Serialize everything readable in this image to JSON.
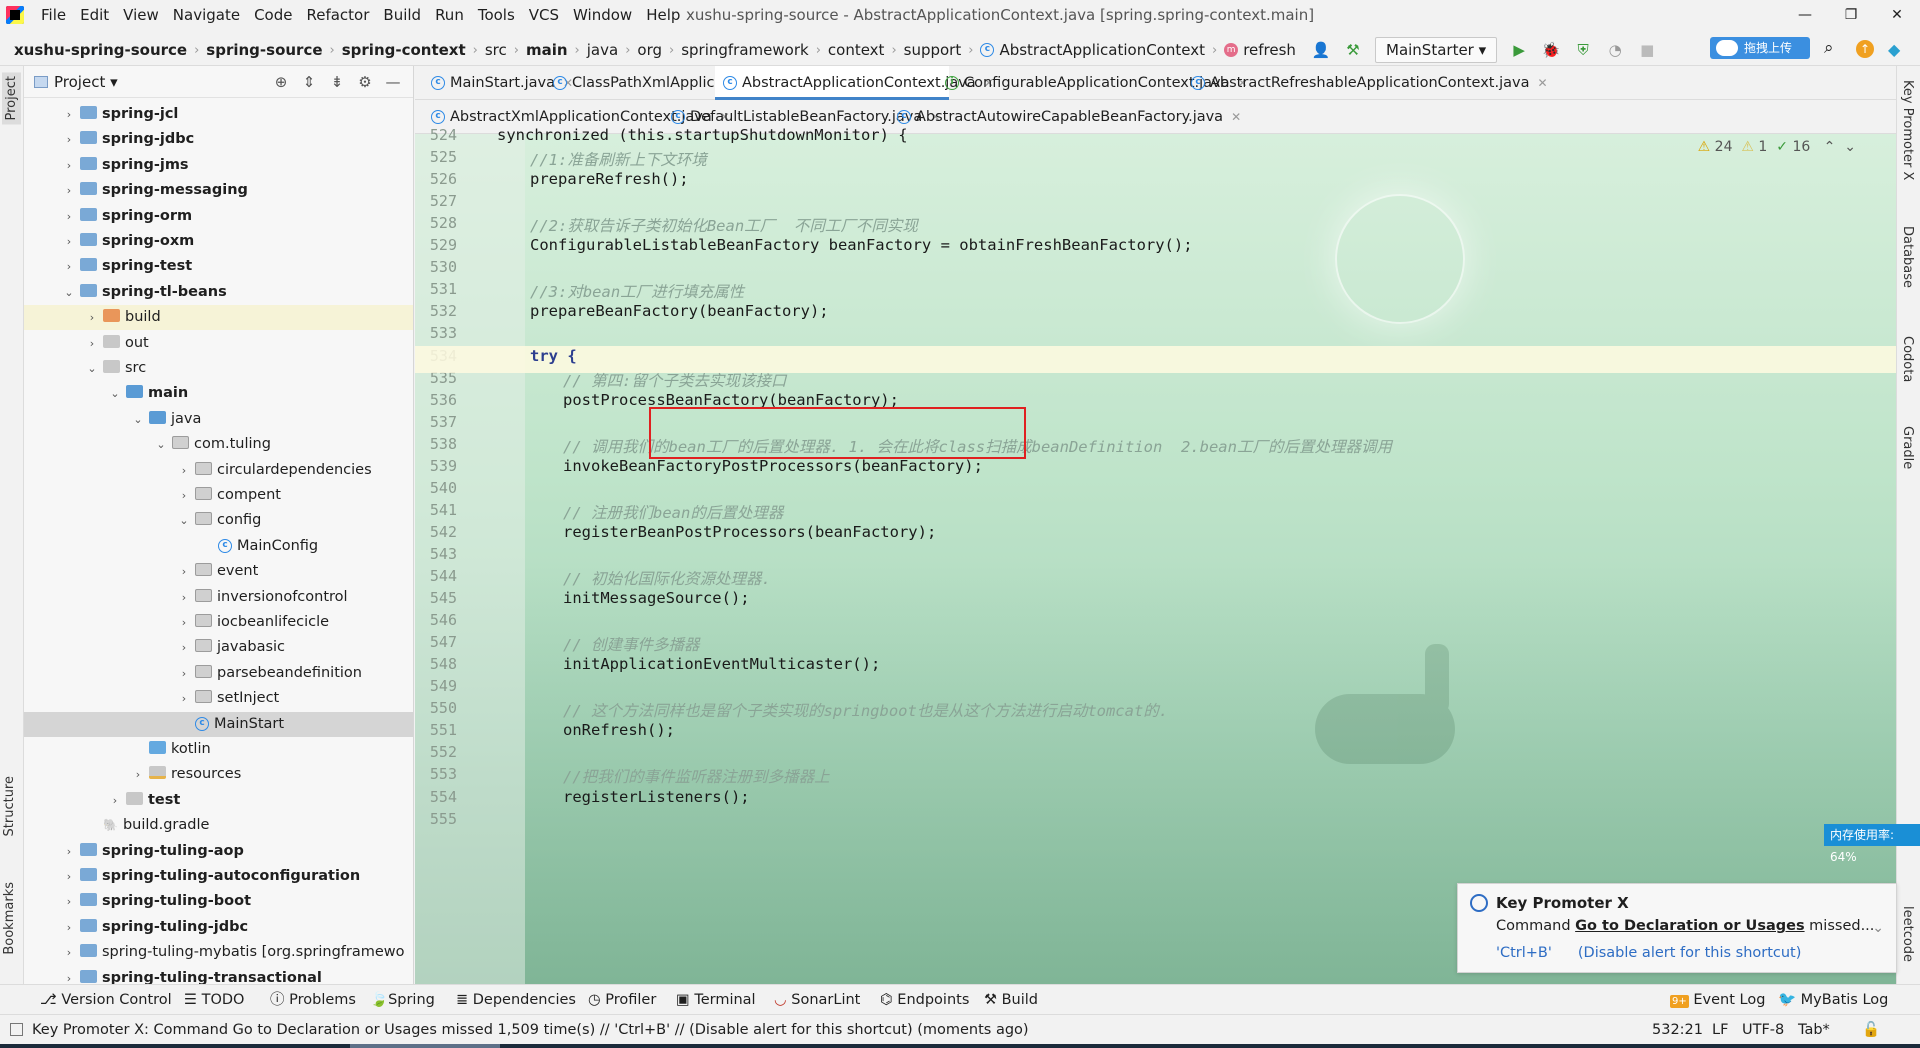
{
  "window": {
    "title": "xushu-spring-source - AbstractApplicationContext.java [spring.spring-context.main]",
    "controls": [
      "—",
      "❐",
      "✕"
    ]
  },
  "menu": [
    "File",
    "Edit",
    "View",
    "Navigate",
    "Code",
    "Refactor",
    "Build",
    "Run",
    "Tools",
    "VCS",
    "Window",
    "Help"
  ],
  "breadcrumbs": [
    "xushu-spring-source",
    "spring-source",
    "spring-context",
    "src",
    "main",
    "java",
    "org",
    "springframework",
    "context",
    "support",
    "AbstractApplicationContext",
    "refresh"
  ],
  "run_config": "MainStarter",
  "upload_button": "拖拽上传",
  "left_strip": [
    "Project",
    "Structure",
    "Bookmarks"
  ],
  "right_strip": [
    "Key Promoter X",
    "Database",
    "Codota",
    "Gradle",
    "leetcode"
  ],
  "project_panel": {
    "title": "Project",
    "tree": [
      {
        "label": "spring-jcl",
        "depth": 0,
        "arrow": "›",
        "icon": "module",
        "bold": true
      },
      {
        "label": "spring-jdbc",
        "depth": 0,
        "arrow": "›",
        "icon": "module",
        "bold": true
      },
      {
        "label": "spring-jms",
        "depth": 0,
        "arrow": "›",
        "icon": "module",
        "bold": true
      },
      {
        "label": "spring-messaging",
        "depth": 0,
        "arrow": "›",
        "icon": "module",
        "bold": true
      },
      {
        "label": "spring-orm",
        "depth": 0,
        "arrow": "›",
        "icon": "module",
        "bold": true
      },
      {
        "label": "spring-oxm",
        "depth": 0,
        "arrow": "›",
        "icon": "module",
        "bold": true
      },
      {
        "label": "spring-test",
        "depth": 0,
        "arrow": "›",
        "icon": "module",
        "bold": true
      },
      {
        "label": "spring-tl-beans",
        "depth": 0,
        "arrow": "⌄",
        "icon": "module",
        "bold": true
      },
      {
        "label": "build",
        "depth": 1,
        "arrow": "›",
        "icon": "orange",
        "bold": false
      },
      {
        "label": "out",
        "depth": 1,
        "arrow": "›",
        "icon": "plain",
        "bold": false
      },
      {
        "label": "src",
        "depth": 1,
        "arrow": "⌄",
        "icon": "plain",
        "bold": false
      },
      {
        "label": "main",
        "depth": 2,
        "arrow": "⌄",
        "icon": "src",
        "bold": true
      },
      {
        "label": "java",
        "depth": 3,
        "arrow": "⌄",
        "icon": "src",
        "bold": false
      },
      {
        "label": "com.tuling",
        "depth": 4,
        "arrow": "⌄",
        "icon": "pkg",
        "bold": false
      },
      {
        "label": "circulardependencies",
        "depth": 5,
        "arrow": "›",
        "icon": "pkg",
        "bold": false
      },
      {
        "label": "compent",
        "depth": 5,
        "arrow": "›",
        "icon": "pkg",
        "bold": false
      },
      {
        "label": "config",
        "depth": 5,
        "arrow": "⌄",
        "icon": "pkg",
        "bold": false
      },
      {
        "label": "MainConfig",
        "depth": 6,
        "arrow": "",
        "icon": "class",
        "bold": false
      },
      {
        "label": "event",
        "depth": 5,
        "arrow": "›",
        "icon": "pkg",
        "bold": false
      },
      {
        "label": "inversionofcontrol",
        "depth": 5,
        "arrow": "›",
        "icon": "pkg",
        "bold": false
      },
      {
        "label": "iocbeanlifecicle",
        "depth": 5,
        "arrow": "›",
        "icon": "pkg",
        "bold": false
      },
      {
        "label": "javabasic",
        "depth": 5,
        "arrow": "›",
        "icon": "pkg",
        "bold": false
      },
      {
        "label": "parsebeandefinition",
        "depth": 5,
        "arrow": "›",
        "icon": "pkg",
        "bold": false
      },
      {
        "label": "setInject",
        "depth": 5,
        "arrow": "›",
        "icon": "pkg",
        "bold": false
      },
      {
        "label": "MainStart",
        "depth": 5,
        "arrow": "",
        "icon": "class",
        "bold": false
      },
      {
        "label": "kotlin",
        "depth": 3,
        "arrow": "",
        "icon": "kt",
        "bold": false
      },
      {
        "label": "resources",
        "depth": 3,
        "arrow": "›",
        "icon": "res",
        "bold": false
      },
      {
        "label": "test",
        "depth": 2,
        "arrow": "›",
        "icon": "plain",
        "bold": true
      },
      {
        "label": "build.gradle",
        "depth": 1,
        "arrow": "",
        "icon": "gradle",
        "bold": false
      },
      {
        "label": "spring-tuling-aop",
        "depth": 0,
        "arrow": "›",
        "icon": "module",
        "bold": true
      },
      {
        "label": "spring-tuling-autoconfiguration",
        "depth": 0,
        "arrow": "›",
        "icon": "module",
        "bold": true
      },
      {
        "label": "spring-tuling-boot",
        "depth": 0,
        "arrow": "›",
        "icon": "module",
        "bold": true
      },
      {
        "label": "spring-tuling-jdbc",
        "depth": 0,
        "arrow": "›",
        "icon": "module",
        "bold": true
      },
      {
        "label": "spring-tuling-mybatis [org.springframewo",
        "depth": 0,
        "arrow": "›",
        "icon": "module",
        "bold": false
      },
      {
        "label": "spring-tuling-transactional",
        "depth": 0,
        "arrow": "›",
        "icon": "module",
        "bold": true
      }
    ]
  },
  "tabs_row1": [
    {
      "label": "MainStart.java",
      "icon": "c",
      "active": false
    },
    {
      "label": "ClassPathXmlApplicationContext.java",
      "icon": "c",
      "active": false
    },
    {
      "label": "AbstractApplicationContext.java",
      "icon": "c",
      "active": true
    },
    {
      "label": "ConfigurableApplicationContext.java",
      "icon": "i",
      "active": false
    },
    {
      "label": "AbstractRefreshableApplicationContext.java",
      "icon": "c",
      "active": false
    }
  ],
  "tabs_row2": [
    {
      "label": "AbstractXmlApplicationContext.java",
      "icon": "c"
    },
    {
      "label": "DefaultListableBeanFactory.java",
      "icon": "c"
    },
    {
      "label": "AbstractAutowireCapableBeanFactory.java",
      "icon": "c"
    }
  ],
  "inspections": {
    "warnings": "24",
    "weak": "1",
    "ok": "16"
  },
  "code_lines": [
    {
      "n": "524",
      "indent": 2,
      "text": "synchronized (this.startupShutdownMonitor) {",
      "kind": "code"
    },
    {
      "n": "525",
      "indent": 3,
      "text": "//1:准备刷新上下文环境",
      "kind": "comment"
    },
    {
      "n": "526",
      "indent": 3,
      "text": "prepareRefresh();",
      "kind": "code"
    },
    {
      "n": "527",
      "indent": 3,
      "text": "",
      "kind": "code"
    },
    {
      "n": "528",
      "indent": 3,
      "text": "//2:获取告诉子类初始化Bean工厂  不同工厂不同实现",
      "kind": "comment"
    },
    {
      "n": "529",
      "indent": 3,
      "text": "ConfigurableListableBeanFactory beanFactory = obtainFreshBeanFactory();",
      "kind": "code"
    },
    {
      "n": "530",
      "indent": 3,
      "text": "",
      "kind": "code"
    },
    {
      "n": "531",
      "indent": 3,
      "text": "//3:对bean工厂进行填充属性",
      "kind": "comment"
    },
    {
      "n": "532",
      "indent": 3,
      "text": "prepareBeanFactory(beanFactory);",
      "kind": "code"
    },
    {
      "n": "533",
      "indent": 3,
      "text": "",
      "kind": "code"
    },
    {
      "n": "534",
      "indent": 3,
      "text": "try {",
      "kind": "keyword"
    },
    {
      "n": "535",
      "indent": 4,
      "text": "// 第四:留个子类去实现该接口",
      "kind": "comment"
    },
    {
      "n": "536",
      "indent": 4,
      "text": "postProcessBeanFactory(beanFactory);",
      "kind": "code"
    },
    {
      "n": "537",
      "indent": 4,
      "text": "",
      "kind": "code"
    },
    {
      "n": "538",
      "indent": 4,
      "text": "// 调用我们的bean工厂的后置处理器. 1. 会在此将class扫描成beanDefinition  2.bean工厂的后置处理器调用",
      "kind": "comment"
    },
    {
      "n": "539",
      "indent": 4,
      "text": "invokeBeanFactoryPostProcessors(beanFactory);",
      "kind": "code"
    },
    {
      "n": "540",
      "indent": 4,
      "text": "",
      "kind": "code"
    },
    {
      "n": "541",
      "indent": 4,
      "text": "// 注册我们bean的后置处理器",
      "kind": "comment"
    },
    {
      "n": "542",
      "indent": 4,
      "text": "registerBeanPostProcessors(beanFactory);",
      "kind": "code"
    },
    {
      "n": "543",
      "indent": 4,
      "text": "",
      "kind": "code"
    },
    {
      "n": "544",
      "indent": 4,
      "text": "// 初始化国际化资源处理器.",
      "kind": "comment"
    },
    {
      "n": "545",
      "indent": 4,
      "text": "initMessageSource();",
      "kind": "code"
    },
    {
      "n": "546",
      "indent": 4,
      "text": "",
      "kind": "code"
    },
    {
      "n": "547",
      "indent": 4,
      "text": "// 创建事件多播器",
      "kind": "comment"
    },
    {
      "n": "548",
      "indent": 4,
      "text": "initApplicationEventMulticaster();",
      "kind": "code"
    },
    {
      "n": "549",
      "indent": 4,
      "text": "",
      "kind": "code"
    },
    {
      "n": "550",
      "indent": 4,
      "text": "// 这个方法同样也是留个子类实现的springboot也是从这个方法进行启动tomcat的.",
      "kind": "comment"
    },
    {
      "n": "551",
      "indent": 4,
      "text": "onRefresh();",
      "kind": "code"
    },
    {
      "n": "552",
      "indent": 4,
      "text": "",
      "kind": "code"
    },
    {
      "n": "553",
      "indent": 4,
      "text": "//把我们的事件监听器注册到多播器上",
      "kind": "comment"
    },
    {
      "n": "554",
      "indent": 4,
      "text": "registerListeners();",
      "kind": "code"
    },
    {
      "n": "555",
      "indent": 4,
      "text": "",
      "kind": "code"
    }
  ],
  "memory_badge": "内存使用率: 64%",
  "key_promoter": {
    "title": "Key Promoter X",
    "message_prefix": "Command ",
    "message_action": "Go to Declaration or Usages",
    "message_suffix": " missed...",
    "shortcut": "'Ctrl+B'",
    "disable": "(Disable alert for this shortcut)"
  },
  "bottom_tools": [
    "Version Control",
    "TODO",
    "Problems",
    "Spring",
    "Dependencies",
    "Profiler",
    "Terminal",
    "SonarLint",
    "Endpoints",
    "Build"
  ],
  "bottom_right_tools": [
    "Event Log",
    "MyBatis Log"
  ],
  "event_log_count": "9+",
  "status": {
    "message": "Key Promoter X: Command Go to Declaration or Usages missed 1,509 time(s) // 'Ctrl+B' // (Disable alert for this shortcut) (moments ago)",
    "position": "532:21",
    "line_sep": "LF",
    "encoding": "UTF-8",
    "indent": "Tab*"
  },
  "colors": {
    "accent": "#4083c9",
    "highlight_box": "#e02020",
    "editor_bg": "#cfe8d6"
  }
}
